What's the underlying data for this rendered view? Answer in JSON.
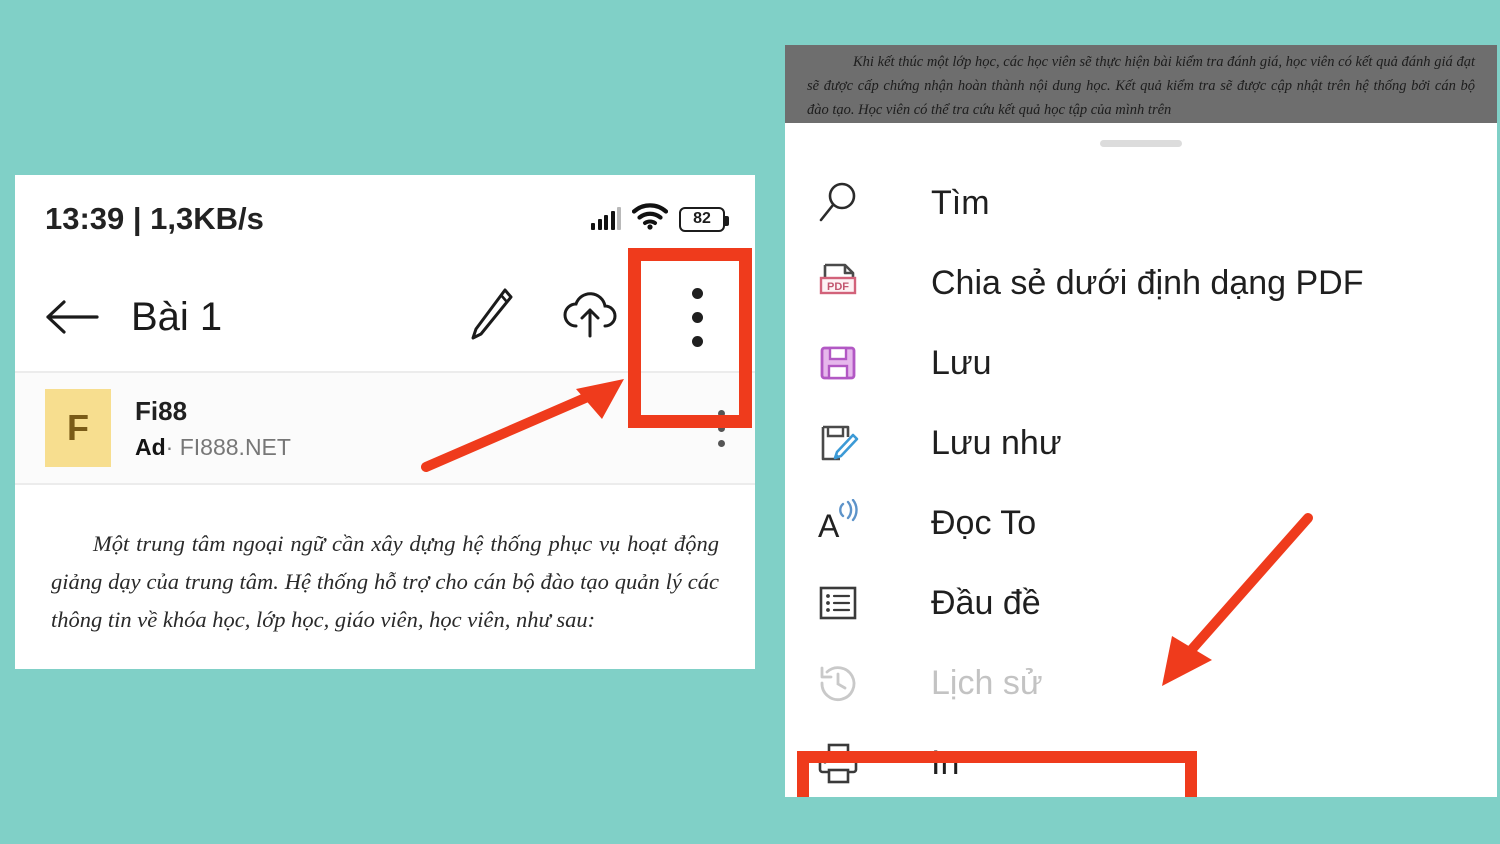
{
  "theme": {
    "background": "#80d0c7",
    "accent_red": "#ef3b1c",
    "panel_white": "#ffffff",
    "ad_logo_bg": "#f7de8f",
    "dim_overlay": "#6e6e6e"
  },
  "left_panel": {
    "status_bar": {
      "clock_and_rate": "13:39 | 1,3KB/s",
      "signal_icon": "signal-bars-icon",
      "wifi_icon": "wifi-icon",
      "battery_icon": "battery-icon",
      "battery_level": "82"
    },
    "toolbar": {
      "back_icon": "back-arrow-icon",
      "title": "Bài 1",
      "edit_icon": "pencil-icon",
      "upload_icon": "cloud-upload-icon",
      "overflow_icon": "kebab-menu-icon"
    },
    "ad": {
      "logo_letter": "F",
      "title": "Fi88",
      "badge": "Ad",
      "separator": "·",
      "domain": "FI888.NET",
      "overflow_icon": "kebab-menu-icon"
    },
    "document_text": "Một trung tâm ngoại ngữ cần xây dựng hệ thống phục vụ hoạt động giảng dạy của trung tâm. Hệ thống hỗ trợ cho cán bộ đào tạo quản lý các thông tin về khóa học, lớp học, giáo viên, học viên, như sau:"
  },
  "right_panel": {
    "dimmed_document_text": "Khi kết thúc một lớp học, các học viên sẽ thực hiện bài kiểm tra đánh giá, học viên có kết quả đánh giá đạt sẽ được cấp chứng nhận hoàn thành nội dung học. Kết quả kiểm tra sẽ được cập nhật trên hệ thống bởi cán bộ đào tạo. Học viên có thể tra cứu kết quả học tập của mình trên",
    "drag_handle": "sheet-drag-handle",
    "menu_items": [
      {
        "label": "Tìm",
        "icon": "search-icon",
        "disabled": false,
        "highlighted": false
      },
      {
        "label": "Chia sẻ dưới định dạng PDF",
        "icon": "share-pdf-icon",
        "disabled": false,
        "highlighted": false
      },
      {
        "label": "Lưu",
        "icon": "save-floppy-icon",
        "disabled": false,
        "highlighted": false
      },
      {
        "label": "Lưu như",
        "icon": "save-as-icon",
        "disabled": false,
        "highlighted": false
      },
      {
        "label": "Đọc To",
        "icon": "read-aloud-icon",
        "disabled": false,
        "highlighted": false
      },
      {
        "label": "Đầu đề",
        "icon": "outline-list-icon",
        "disabled": false,
        "highlighted": false
      },
      {
        "label": "Lịch sử",
        "icon": "history-icon",
        "disabled": true,
        "highlighted": false
      },
      {
        "label": "In",
        "icon": "printer-icon",
        "disabled": false,
        "highlighted": true
      }
    ]
  },
  "annotations": {
    "kebab_highlight_box": "red-rectangle-highlight",
    "print_highlight_box": "red-rectangle-highlight",
    "arrow_to_kebab": "red-arrow-pointing-up-right",
    "arrow_to_print": "red-arrow-pointing-down-left"
  }
}
